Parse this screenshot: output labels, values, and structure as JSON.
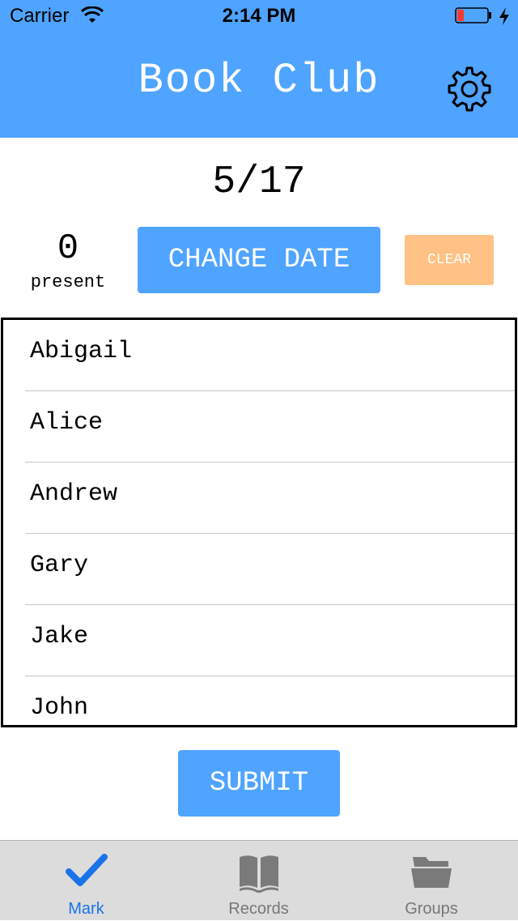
{
  "status_bar": {
    "carrier": "Carrier",
    "time": "2:14 PM",
    "battery_color": "#ff3b30"
  },
  "header": {
    "title": "Book Club",
    "settings_icon": "gear-icon"
  },
  "session": {
    "date": "5/17",
    "present_count": "0",
    "present_label": "present",
    "change_date_label": "CHANGE DATE",
    "clear_label": "CLEAR"
  },
  "members": [
    {
      "name": "Abigail"
    },
    {
      "name": "Alice"
    },
    {
      "name": "Andrew"
    },
    {
      "name": "Gary"
    },
    {
      "name": "Jake"
    },
    {
      "name": "John"
    }
  ],
  "submit_label": "SUBMIT",
  "tabs": [
    {
      "label": "Mark",
      "icon": "checkmark-icon",
      "active": true
    },
    {
      "label": "Records",
      "icon": "book-icon",
      "active": false
    },
    {
      "label": "Groups",
      "icon": "folder-icon",
      "active": false
    }
  ],
  "colors": {
    "accent": "#4fa4ff",
    "clear": "#ffc184",
    "tab_active": "#1a73e8",
    "tab_inactive": "#777777"
  }
}
